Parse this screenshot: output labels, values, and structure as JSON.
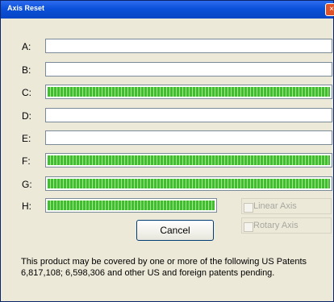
{
  "window": {
    "title": "Axis Reset",
    "close_glyph": "×"
  },
  "axes": [
    {
      "label": "A:",
      "progress": 0
    },
    {
      "label": "B:",
      "progress": 0
    },
    {
      "label": "C:",
      "progress": 1
    },
    {
      "label": "D:",
      "progress": 0
    },
    {
      "label": "E:",
      "progress": 0
    },
    {
      "label": "F:",
      "progress": 1
    },
    {
      "label": "G:",
      "progress": 1
    },
    {
      "label": "H:",
      "progress": 1
    }
  ],
  "options": {
    "linear_label": "Linear Axis",
    "rotary_label": "Rotary Axis",
    "linear_checked": false,
    "rotary_checked": false,
    "enabled": false
  },
  "buttons": {
    "cancel_label": "Cancel"
  },
  "patent_text": "This product may be covered by one or more of the following US Patents 6,817,108; 6,598,306 and other US and foreign patents pending.",
  "colors": {
    "progress_fill": "#3fbf2f",
    "titlebar": "#0a50d8"
  }
}
